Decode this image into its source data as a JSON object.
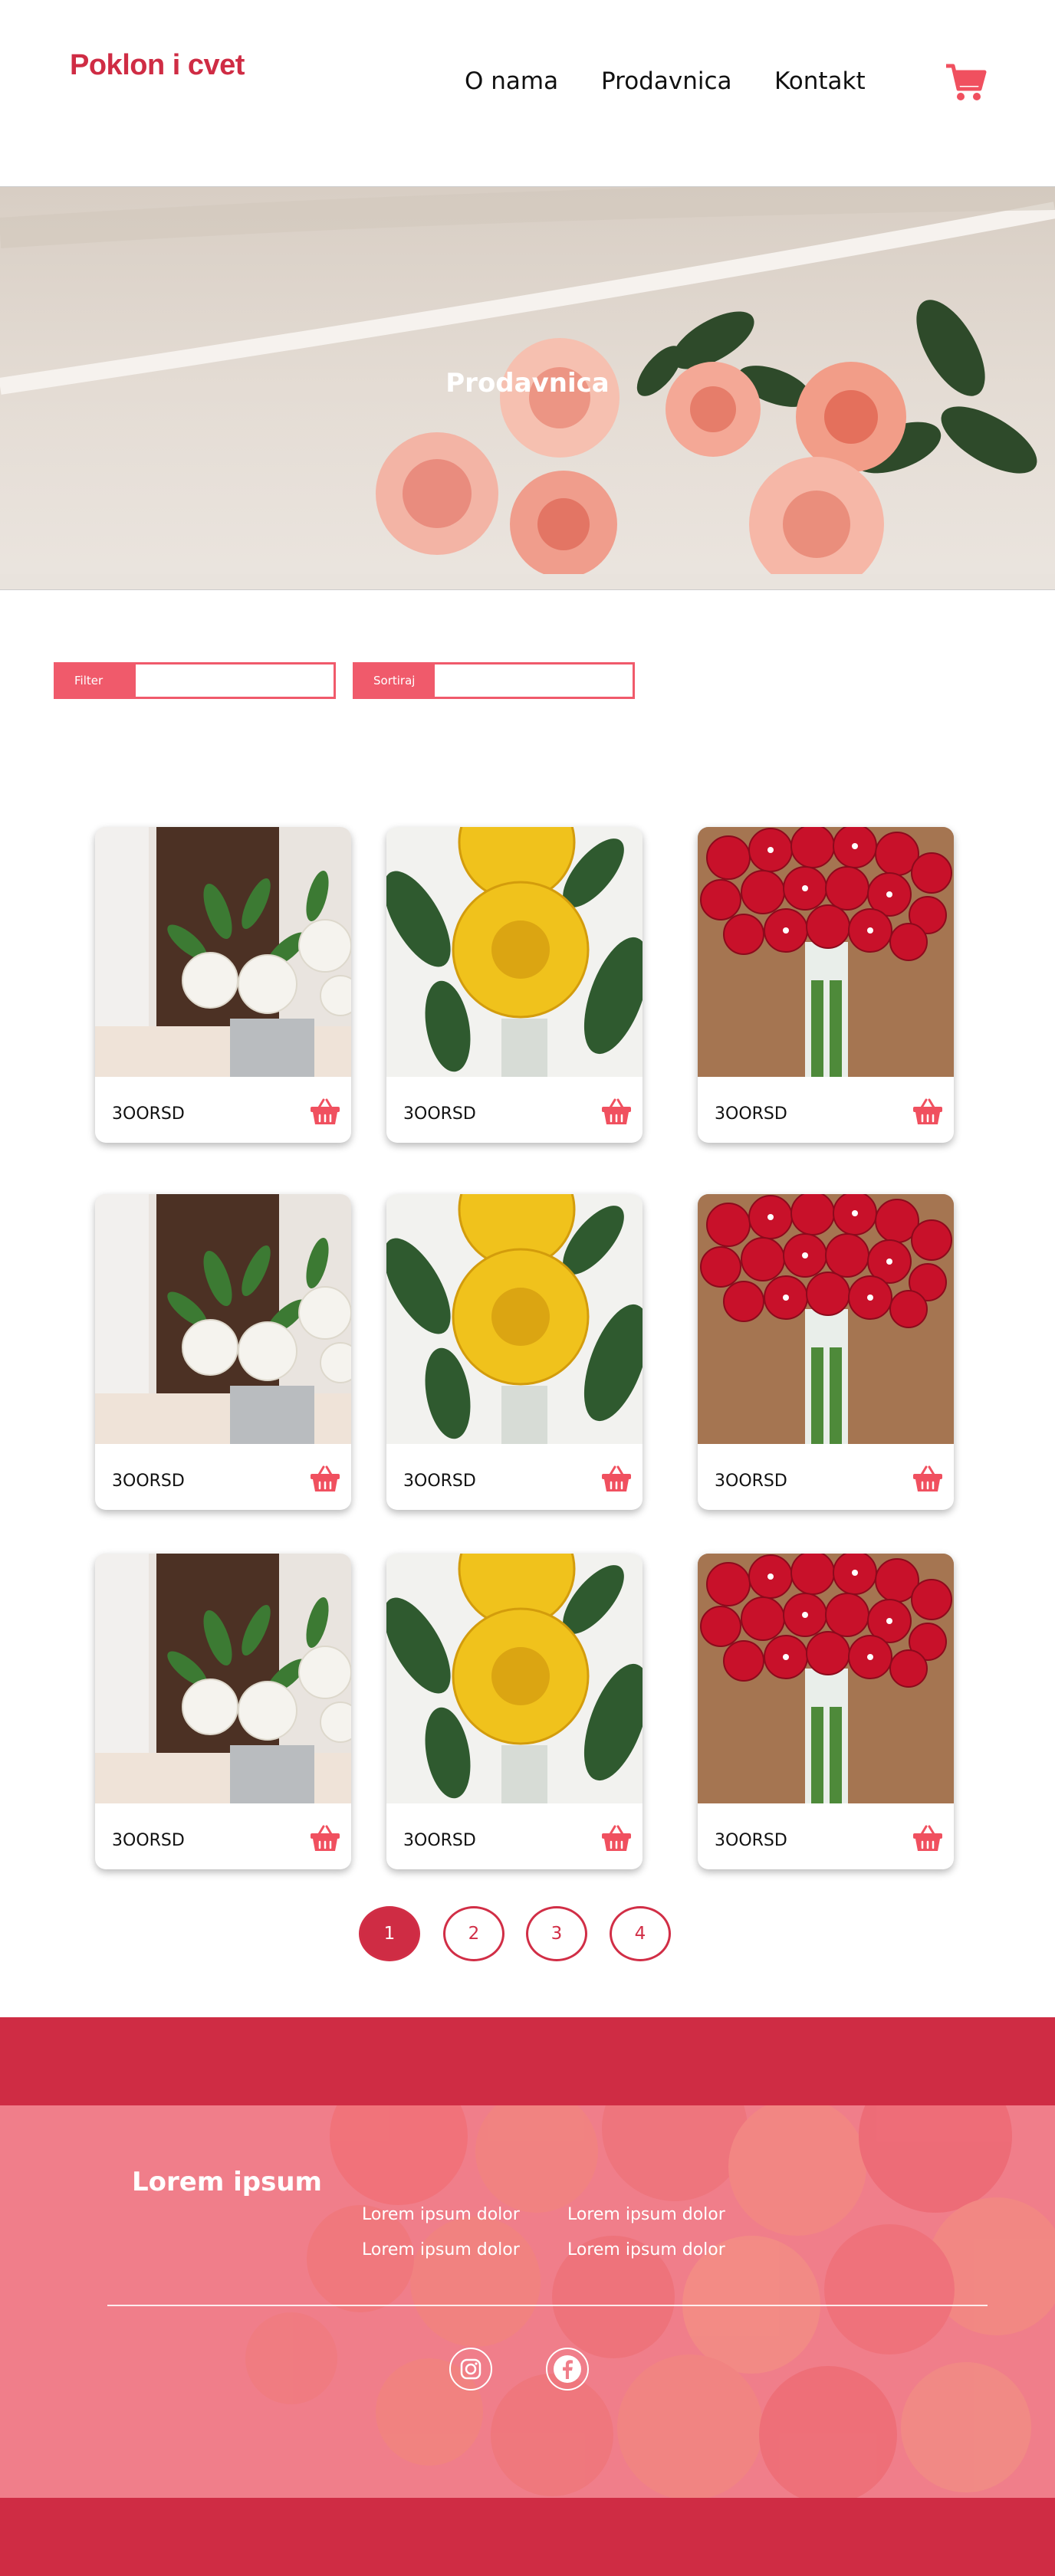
{
  "header": {
    "logo": "Poklon i cvet",
    "nav": [
      "O nama",
      "Prodavnica",
      "Kontakt"
    ],
    "cart_icon": "cart-icon"
  },
  "hero": {
    "title": "Prodavnica"
  },
  "filters": {
    "filter_label": "Filter",
    "filter_value": "",
    "sort_label": "Sortiraj",
    "sort_value": ""
  },
  "products": [
    {
      "price": "3OORSD",
      "image": "white-roses-in-vase"
    },
    {
      "price": "3OORSD",
      "image": "yellow-roses"
    },
    {
      "price": "3OORSD",
      "image": "red-rose-bouquet"
    },
    {
      "price": "3OORSD",
      "image": "white-roses-in-vase"
    },
    {
      "price": "3OORSD",
      "image": "yellow-roses"
    },
    {
      "price": "3OORSD",
      "image": "red-rose-bouquet"
    },
    {
      "price": "3OORSD",
      "image": "white-roses-in-vase"
    },
    {
      "price": "3OORSD",
      "image": "yellow-roses"
    },
    {
      "price": "3OORSD",
      "image": "red-rose-bouquet"
    }
  ],
  "pagination": {
    "pages": [
      "1",
      "2",
      "3",
      "4"
    ],
    "current": "1"
  },
  "footer": {
    "title": "Lorem ipsum",
    "links": [
      "Lorem ipsum dolor",
      "Lorem ipsum dolor",
      "Lorem ipsum dolor",
      "Lorem ipsum dolor"
    ],
    "social": [
      "instagram-icon",
      "facebook-icon"
    ]
  },
  "colors": {
    "brand": "#cf2c44",
    "accent": "#f05a6b",
    "footer_bg": "#f07e8a"
  }
}
